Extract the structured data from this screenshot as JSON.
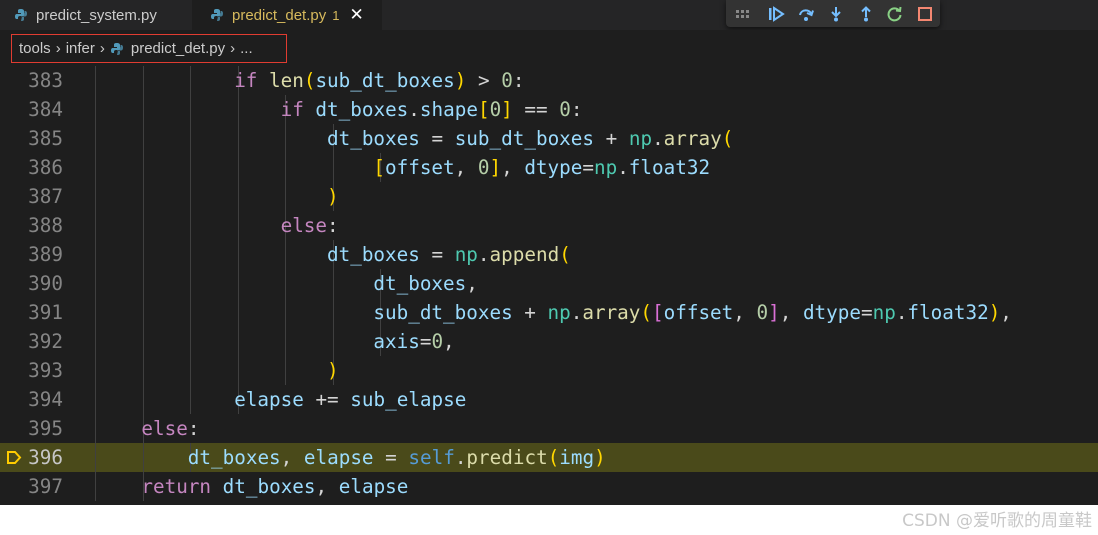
{
  "tabs": [
    {
      "label": "predict_system.py",
      "active": false
    },
    {
      "label": "predict_det.py",
      "active": true,
      "badge": "1",
      "close": "✕"
    }
  ],
  "breadcrumb": {
    "items": [
      "tools",
      "infer",
      "predict_det.py",
      "..."
    ],
    "separator": "›"
  },
  "debug_toolbar": {
    "buttons": [
      "continue",
      "step-over",
      "step-into",
      "step-out",
      "restart",
      "stop"
    ]
  },
  "code": {
    "current_line": 396,
    "lines": [
      {
        "num": "383",
        "indent": 1,
        "text": "if len(sub_dt_boxes) > 0:"
      },
      {
        "num": "384",
        "indent": 2,
        "text": "if dt_boxes.shape[0] == 0:"
      },
      {
        "num": "385",
        "indent": 3,
        "text": "dt_boxes = sub_dt_boxes + np.array("
      },
      {
        "num": "386",
        "indent": 4,
        "text": "[offset, 0], dtype=np.float32"
      },
      {
        "num": "387",
        "indent": 3,
        "text": ")"
      },
      {
        "num": "388",
        "indent": 2,
        "text": "else:"
      },
      {
        "num": "389",
        "indent": 3,
        "text": "dt_boxes = np.append("
      },
      {
        "num": "390",
        "indent": 4,
        "text": "dt_boxes,"
      },
      {
        "num": "391",
        "indent": 4,
        "text": "sub_dt_boxes + np.array([offset, 0], dtype=np.float32),"
      },
      {
        "num": "392",
        "indent": 4,
        "text": "axis=0,"
      },
      {
        "num": "393",
        "indent": 3,
        "text": ")"
      },
      {
        "num": "394",
        "indent": 1,
        "text": "elapse += sub_elapse"
      },
      {
        "num": "395",
        "indent": -1,
        "text": "else:"
      },
      {
        "num": "396",
        "indent": 0,
        "text": "dt_boxes, elapse = self.predict(img)"
      },
      {
        "num": "397",
        "indent": -1,
        "text": "return dt_boxes, elapse"
      }
    ]
  },
  "watermark": "CSDN @爱听歌的周童鞋",
  "colors": {
    "editor_bg": "#1e1e1e",
    "current_line_bg": "#4a4a1a",
    "breakpoint_arrow": "#ffcc00",
    "tab_modified": "#d7ba5d",
    "highlight_box": "#e03c31"
  }
}
